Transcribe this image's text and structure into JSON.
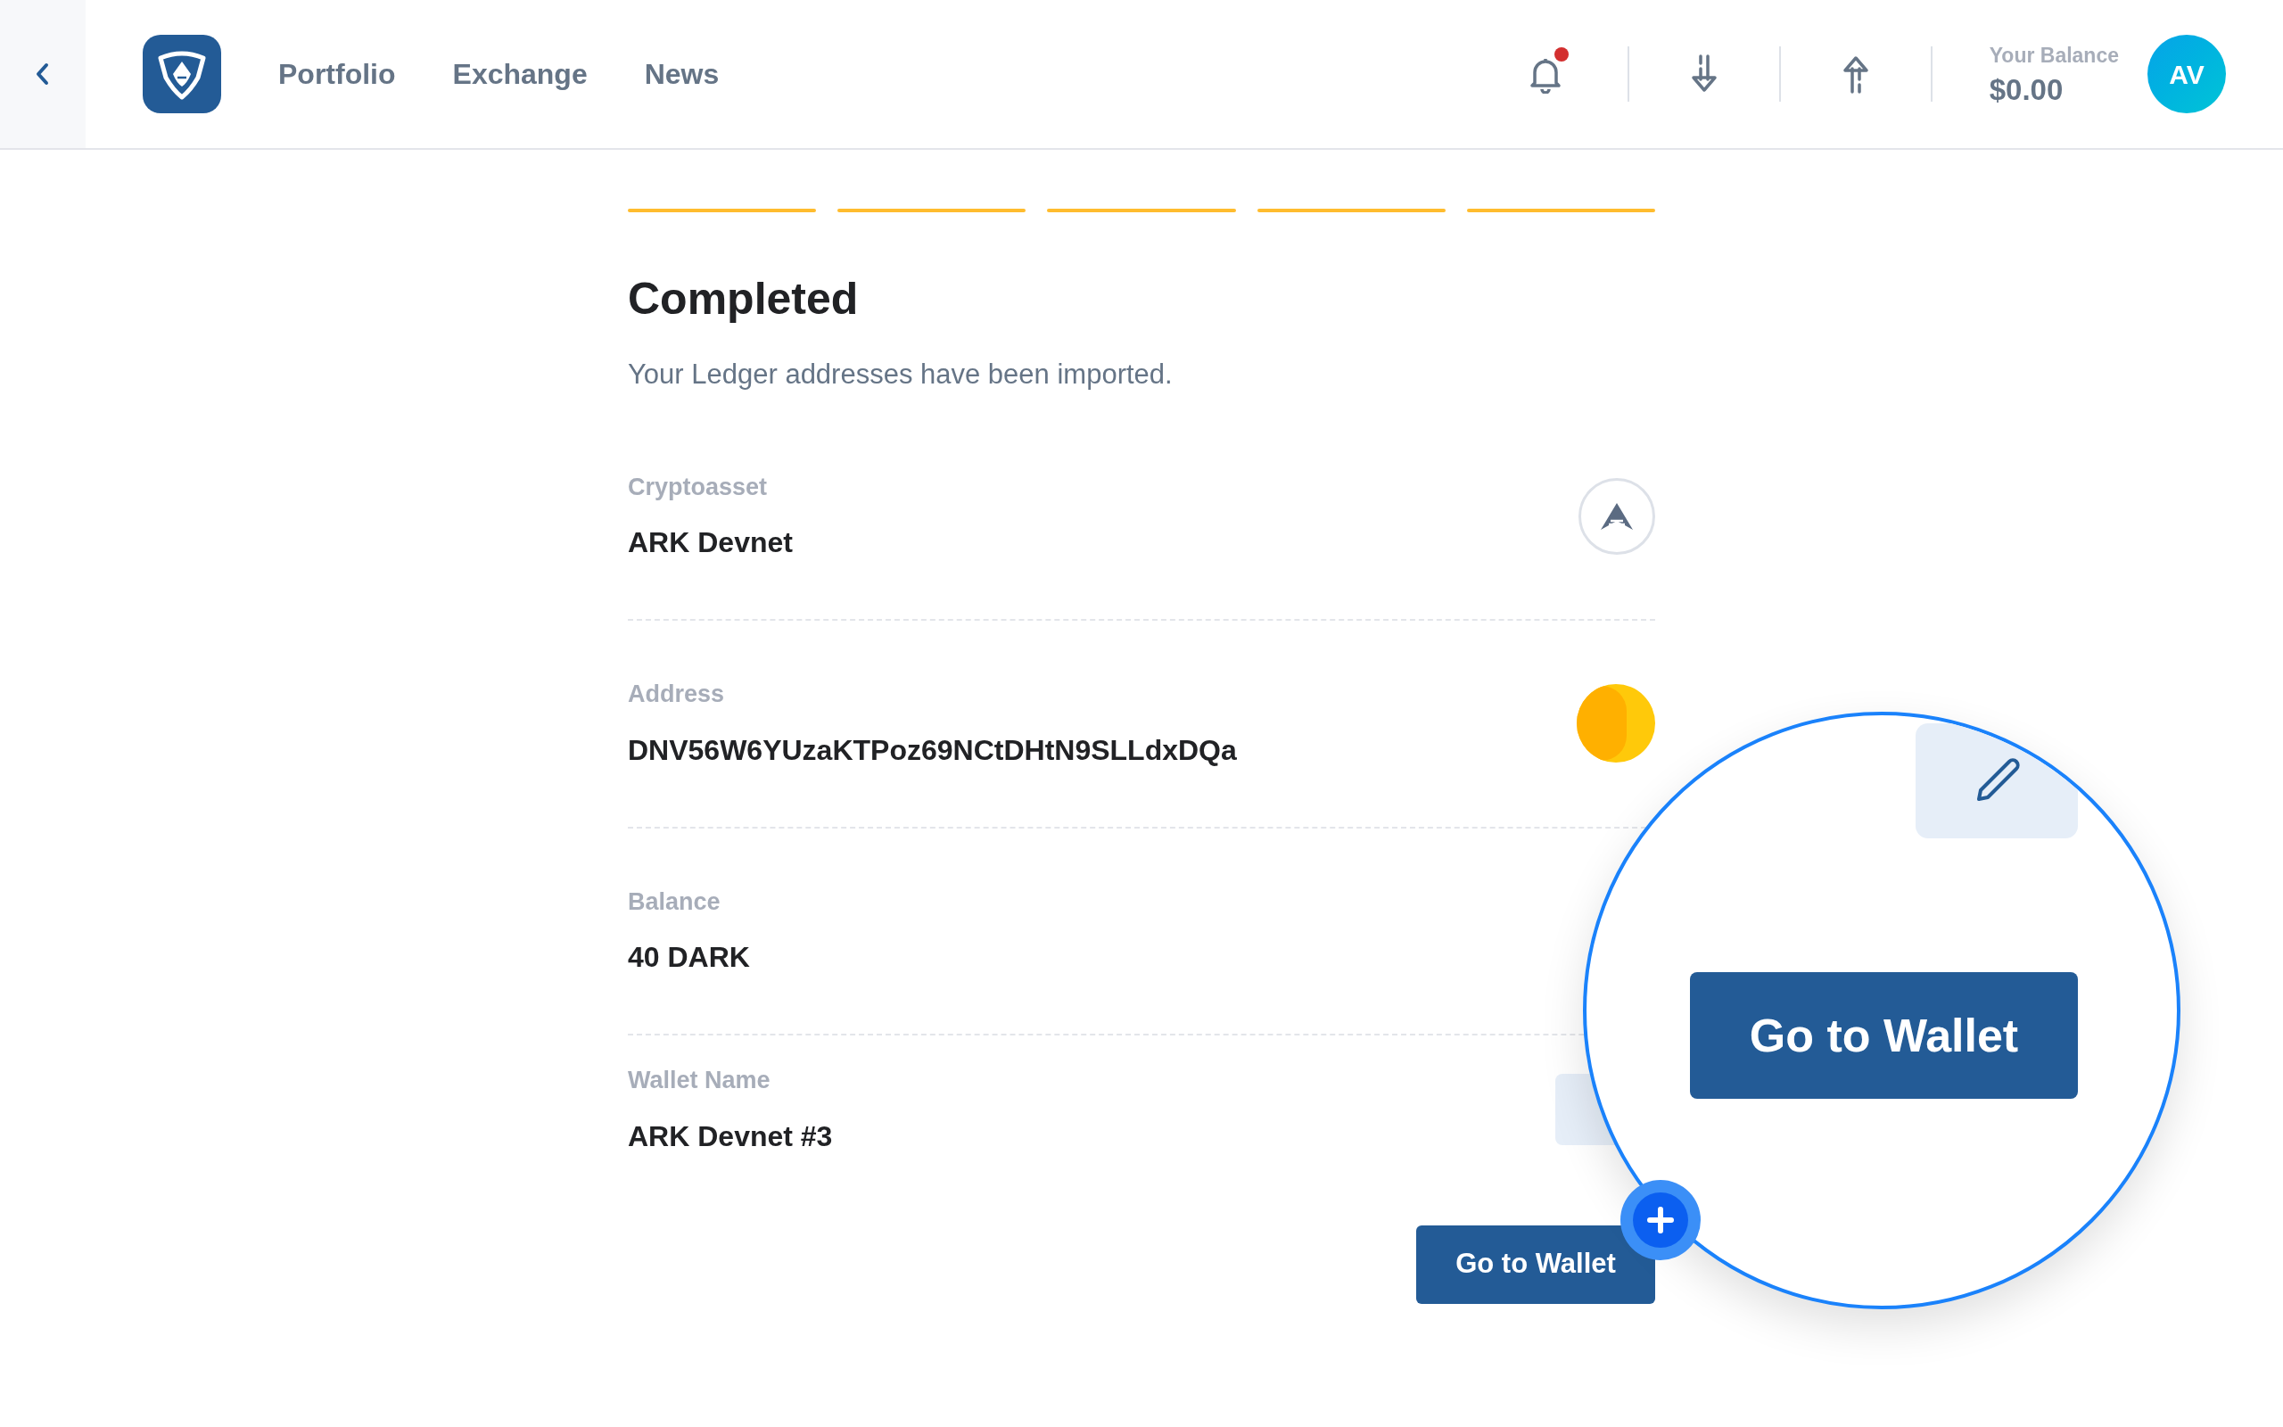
{
  "header": {
    "nav": [
      {
        "label": "Portfolio"
      },
      {
        "label": "Exchange"
      },
      {
        "label": "News"
      }
    ],
    "notification_unread": true,
    "balance": {
      "label": "Your Balance",
      "value": "$0.00"
    },
    "avatar": "AV"
  },
  "steps": [
    {
      "completed": true
    },
    {
      "completed": true
    },
    {
      "completed": true
    },
    {
      "completed": true
    },
    {
      "completed": true
    }
  ],
  "title": "Completed",
  "description": "Your Ledger addresses have been imported.",
  "fields": [
    {
      "kind": "asset",
      "label": "Cryptoasset",
      "value": "ARK Devnet"
    },
    {
      "kind": "address",
      "label": "Address",
      "value": "DNV56W6YUzaKTPoz69NCtDHtN9SLLdxDQa"
    },
    {
      "kind": "plain",
      "label": "Balance",
      "value": "40 DARK"
    },
    {
      "kind": "editable",
      "label": "Wallet Name",
      "value": "ARK Devnet #3"
    }
  ],
  "button": "Go to Wallet",
  "magnifier": {
    "button": "Go to Wallet"
  }
}
